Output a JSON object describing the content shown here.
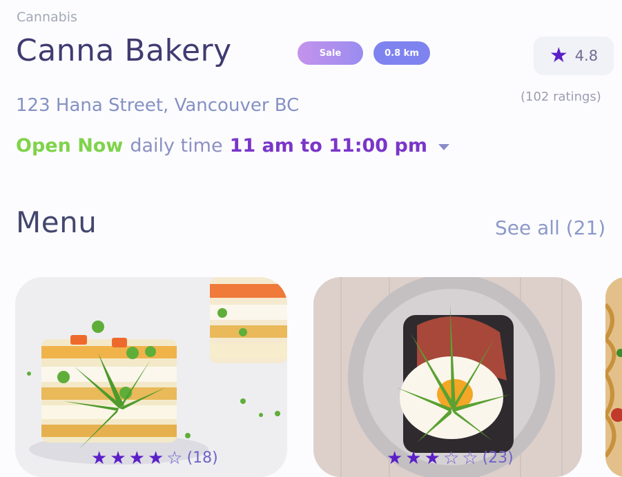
{
  "store": {
    "category": "Cannabis",
    "name": "Canna Bakery",
    "badges": {
      "sale": "Sale",
      "distance": "0.8 km"
    },
    "rating": {
      "value": "4.8",
      "count_label": "(102 ratings)"
    },
    "address": "123 Hana Street, Vancouver BC",
    "hours": {
      "status": "Open Now",
      "label": "daily time",
      "range": "11 am to 11:00 pm"
    }
  },
  "menu": {
    "heading": "Menu",
    "see_all": "See all (21)",
    "items": [
      {
        "image": "egg-sandwich-stack-with-cannabis-leaves",
        "rating": 4,
        "count_label": "(18)"
      },
      {
        "image": "fried-egg-toast-with-cannabis-leaf",
        "rating": 3,
        "count_label": "(23)"
      },
      {
        "image": "pasta-dish-partial"
      }
    ]
  },
  "icons": {
    "rating": "star-icon",
    "dropdown": "chevron-down-icon"
  },
  "colors": {
    "brand": "#403b71",
    "accent_purple": "#5b1fc7",
    "open_green": "#7fd34a",
    "hours_purple": "#7a36c8",
    "badge_sale": "#c493ec",
    "badge_distance": "#7f83f0"
  }
}
